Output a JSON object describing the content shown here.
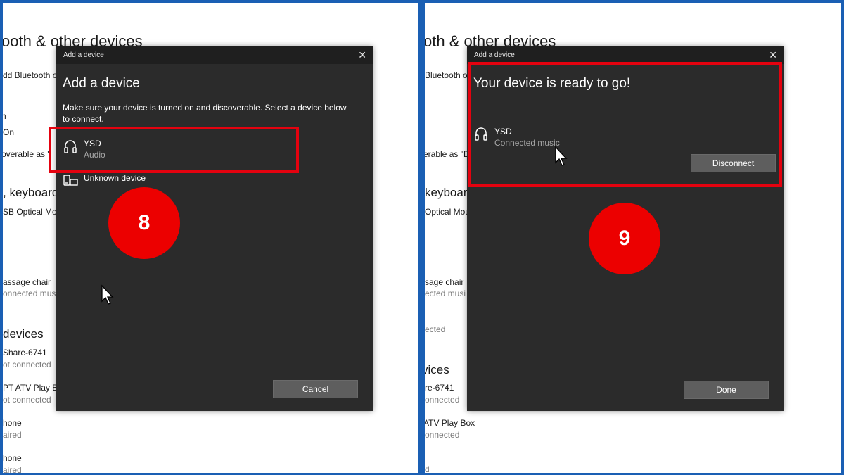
{
  "left_panel": {
    "background": {
      "heading_bluetooth": "ooth & other devices",
      "add_bluetooth": "dd Bluetooth o",
      "bluetooth_label": "h",
      "bluetooth_state": "On",
      "discoverable": "overable as \"",
      "mouse_heading": ", keyboard",
      "mouse_item": "SB Optical Mou",
      "massage_name": "assage chair",
      "massage_status": "onnected musi",
      "other_heading": "devices",
      "share_name": "Share-6741",
      "share_status": "ot connected",
      "atv_name": "PT ATV Play Box",
      "atv_status": "ot connected",
      "phone1_name": "hone",
      "phone1_status": "aired",
      "phone2_name": "hone",
      "phone2_status": "aired"
    },
    "dialog": {
      "window_title": "Add a device",
      "close_glyph": "✕",
      "heading": "Add a device",
      "description": "Make sure your device is turned on and discoverable. Select a device below to connect.",
      "devices": [
        {
          "name": "YSD",
          "status": "Audio",
          "icon": "headphones-icon"
        },
        {
          "name": "Unknown device",
          "icon": "unknown-device-icon"
        }
      ],
      "cancel_label": "Cancel"
    },
    "step_number": "8"
  },
  "right_panel": {
    "background": {
      "heading_bluetooth": "oth & other devices",
      "add_bluetooth": "Bluetooth o",
      "discoverable": "erable as \"DE",
      "mouse_heading": "keyboard",
      "mouse_item": "Optical Mou",
      "massage_name": "sage chair",
      "massage_status": "ected musi",
      "cted_status": "ected",
      "other_heading": "vices",
      "share_name": "re-6741",
      "share_status": "onnected",
      "atv_name": "ATV Play Box",
      "atv_status": "onnected",
      "last_status": "d"
    },
    "dialog": {
      "window_title": "Add a device",
      "close_glyph": "✕",
      "heading": "Your device is ready to go!",
      "device": {
        "name": "YSD",
        "status": "Connected music",
        "icon": "headphones-icon"
      },
      "disconnect_label": "Disconnect",
      "done_label": "Done"
    },
    "step_number": "9"
  },
  "colors": {
    "highlight": "#e4020f",
    "badge": "#ec0000",
    "dialog_bg": "#2b2b2b",
    "frame": "#1a5fb4"
  }
}
